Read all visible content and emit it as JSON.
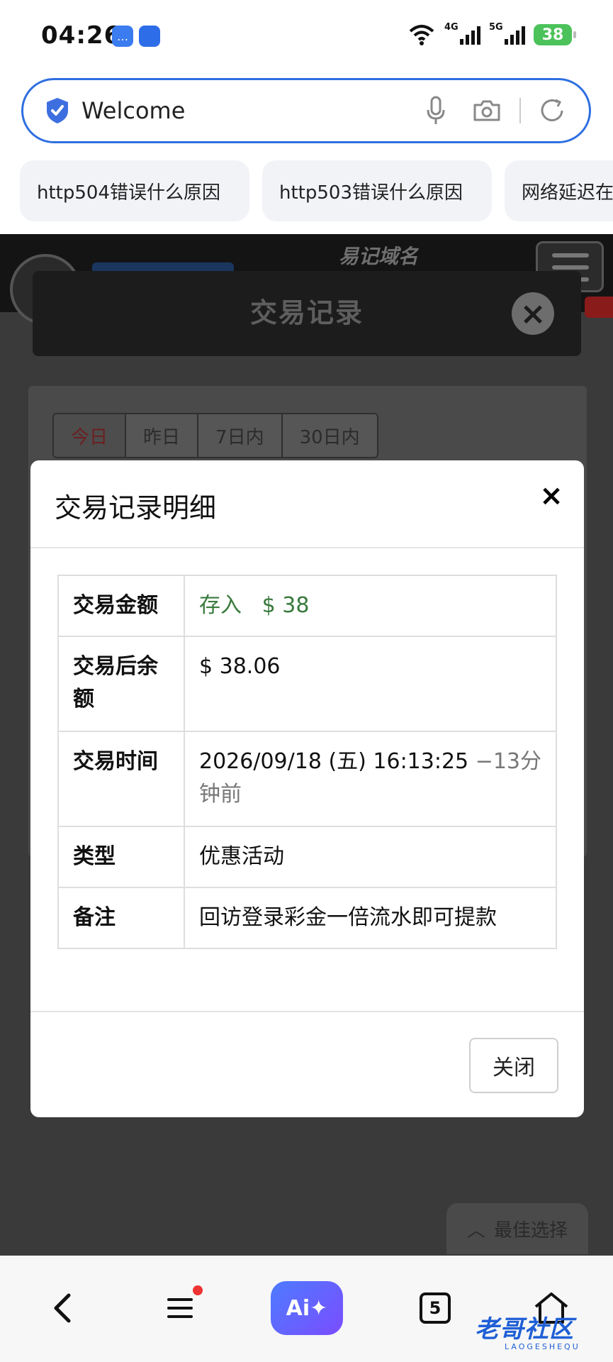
{
  "status_bar": {
    "time": "04:26",
    "app_badge_1": "…",
    "app_badge_2": "",
    "signal_1": "4G",
    "signal_2": "5G",
    "battery": "38"
  },
  "address_bar": {
    "text": "Welcome"
  },
  "suggestions": [
    {
      "label": "http504错误什么原因"
    },
    {
      "label": "http503错误什么原因"
    },
    {
      "label": "网络延迟在"
    }
  ],
  "background_page": {
    "slogan": "易记域名",
    "modal_title": "交易记录",
    "tabs": [
      {
        "label": "今日"
      },
      {
        "label": "昨日"
      },
      {
        "label": "7日内"
      },
      {
        "label": "30日内"
      }
    ],
    "best_choice": "最佳选择"
  },
  "detail_modal": {
    "title": "交易记录明细",
    "close_icon": "×",
    "rows": [
      {
        "key": "交易金额",
        "value_prefix": "存入",
        "value": "$ 38",
        "value_suffix": ""
      },
      {
        "key": "交易后余额",
        "value_prefix": "",
        "value": "$ 38.06",
        "value_suffix": ""
      },
      {
        "key": "交易时间",
        "value_prefix": "",
        "value": "2026/09/18 (五) 16:13:25",
        "value_suffix": "−13分钟前"
      },
      {
        "key": "类型",
        "value_prefix": "",
        "value": "优惠活动",
        "value_suffix": ""
      },
      {
        "key": "备注",
        "value_prefix": "",
        "value": "回访登录彩金一倍流水即可提款",
        "value_suffix": ""
      }
    ],
    "close_button": "关闭"
  },
  "bottom_nav": {
    "ai_label": "Ai✦",
    "tabs_count": "5"
  },
  "watermark": {
    "text": "老哥社区",
    "sub": "LAOGESHEQU"
  },
  "colors": {
    "accent": "#2f6fe0",
    "deposit_green": "#3a7a3e",
    "overlay": "#3a3a3a"
  }
}
